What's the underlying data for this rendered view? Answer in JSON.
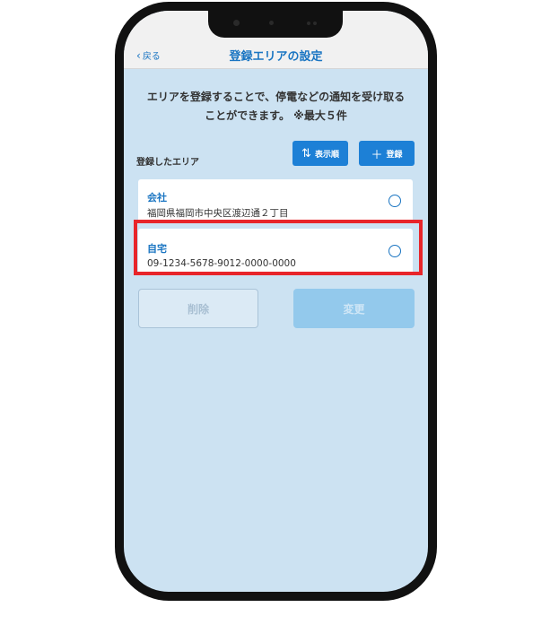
{
  "header": {
    "back_label": "戻る",
    "title": "登録エリアの設定"
  },
  "intro": {
    "line1": "エリアを登録することで、停電などの通知を受け取る",
    "line2": "ことができます。 ※最大５件"
  },
  "registered": {
    "section_label": "登録したエリア",
    "sort_button_label": "表示順",
    "add_button_label": "登録",
    "areas": [
      {
        "name": "会社",
        "detail": "福岡県福岡市中央区渡辺通２丁目",
        "selected": false
      },
      {
        "name": "自宅",
        "detail": "09-1234-5678-9012-0000-0000",
        "selected": false
      }
    ]
  },
  "actions": {
    "delete_label": "削除",
    "change_label": "変更"
  },
  "colors": {
    "accent": "#1a75c2",
    "screen_background": "#cce2f2",
    "highlight": "#e8252a"
  }
}
